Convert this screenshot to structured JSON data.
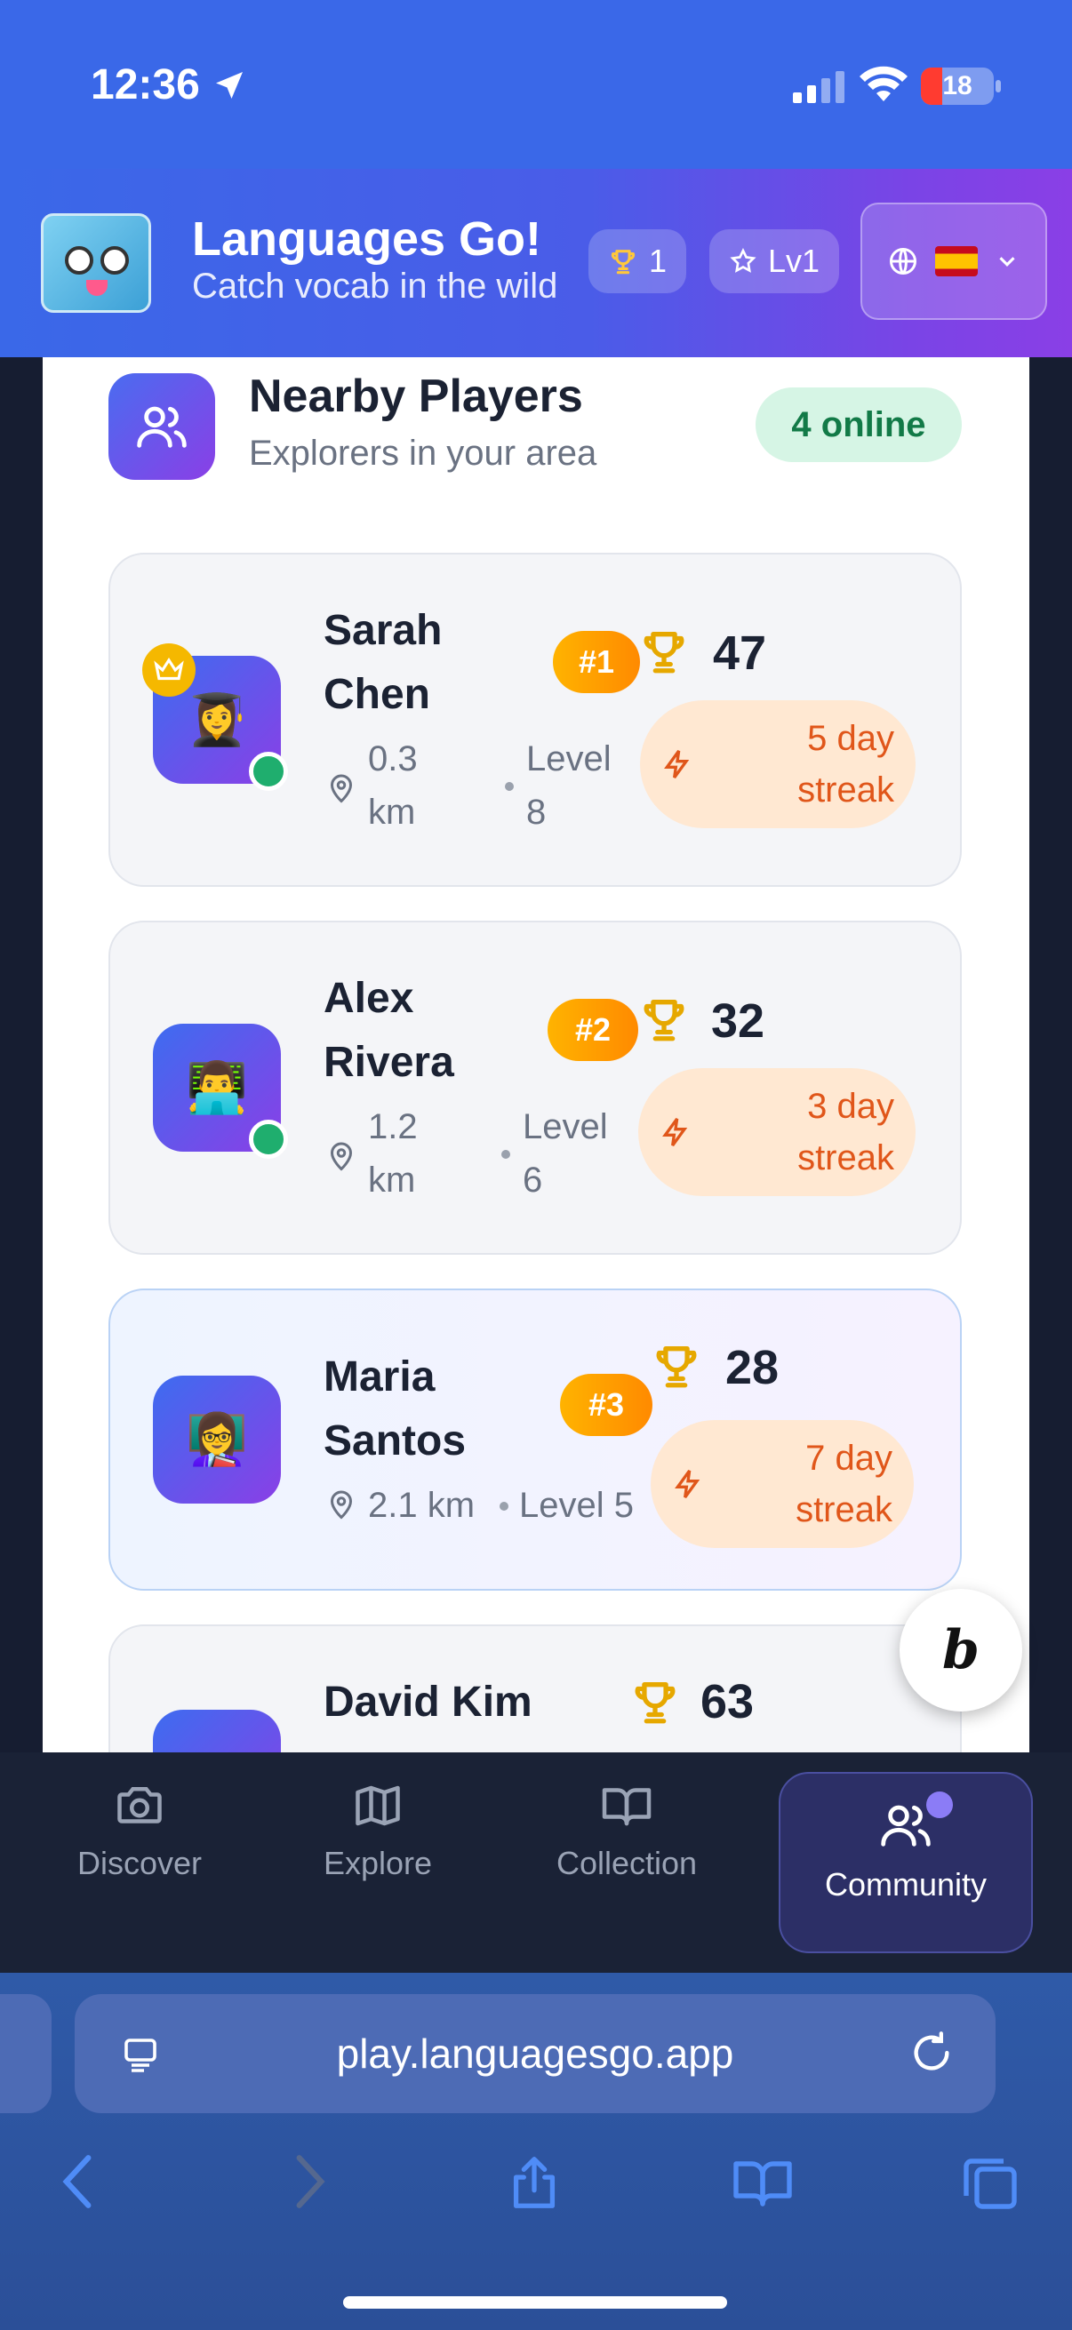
{
  "status_bar": {
    "time": "12:36",
    "battery": "18"
  },
  "header": {
    "title": "Languages Go!",
    "subtitle": "Catch vocab in the wild",
    "trophy_count": "1",
    "level": "Lv1",
    "language_flag": "spain-flag-icon"
  },
  "section": {
    "title": "Nearby Players",
    "subtitle": "Explorers in your area",
    "online_badge": "4 online"
  },
  "players": [
    {
      "first": "Sarah",
      "last": "Chen",
      "rank": "#1",
      "score": "47",
      "distance_1": "0.3",
      "distance_2": "km",
      "level_1": "Level",
      "level_2": "8",
      "streak_1": "5 day",
      "streak_2": "streak",
      "online": true,
      "crown": true,
      "emoji": "👩‍🎓"
    },
    {
      "first": "Alex",
      "last": "Rivera",
      "rank": "#2",
      "score": "32",
      "distance_1": "1.2",
      "distance_2": "km",
      "level_1": "Level",
      "level_2": "6",
      "streak_1": "3 day",
      "streak_2": "streak",
      "online": true,
      "crown": false,
      "emoji": "👨‍💻"
    },
    {
      "first": "Maria",
      "last": "Santos",
      "rank": "#3",
      "score": "28",
      "distance": "2.1 km",
      "level": "Level 5",
      "streak_1": "7 day",
      "streak_2": "streak",
      "online": false,
      "crown": false,
      "emoji": "👩‍🏫"
    },
    {
      "name": "David Kim",
      "score": "63"
    }
  ],
  "nav": {
    "items": [
      {
        "label": "Discover",
        "icon": "camera-icon"
      },
      {
        "label": "Explore",
        "icon": "map-icon"
      },
      {
        "label": "Collection",
        "icon": "book-icon"
      },
      {
        "label": "Community",
        "icon": "users-icon",
        "active": true
      }
    ]
  },
  "browser": {
    "url": "play.languagesgo.app"
  },
  "colors": {
    "accent": "#4a5ce8",
    "brand_purple": "#8a3fe6",
    "online_green": "#1fae6e",
    "streak_orange": "#e0561a"
  }
}
